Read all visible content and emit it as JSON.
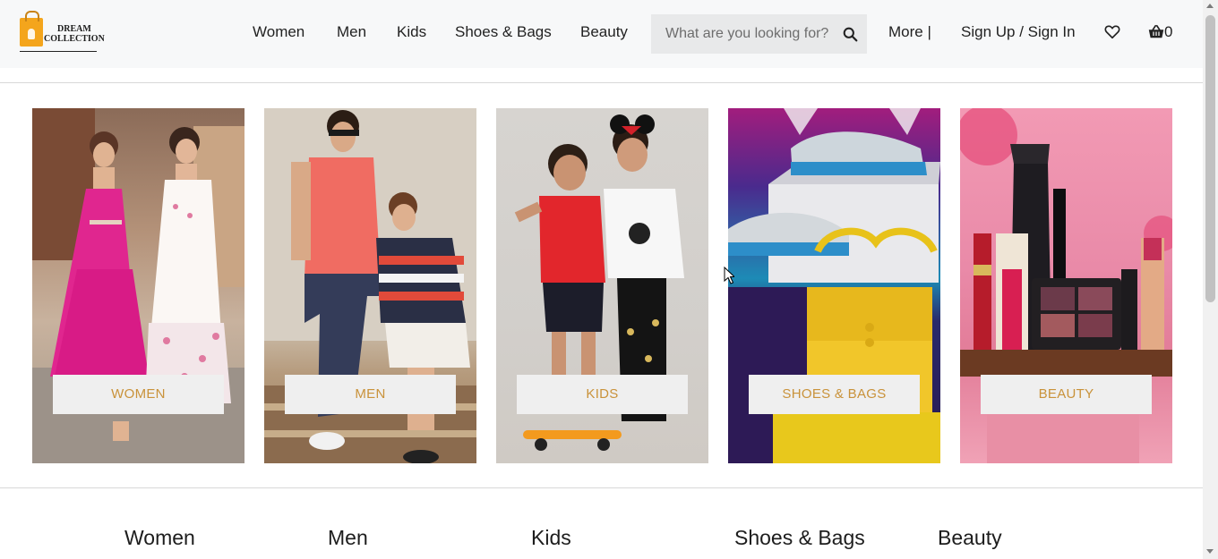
{
  "brand": {
    "logo_line1": "DREAM",
    "logo_line2": "COLLECTION"
  },
  "nav": {
    "items": [
      "Women",
      "Men",
      "Kids",
      "Shoes & Bags",
      "Beauty"
    ],
    "more": "More |",
    "signin": "Sign Up / Sign In",
    "cart_count": "0"
  },
  "search": {
    "placeholder": "What are you looking for?",
    "icon": "search-icon"
  },
  "icons": {
    "wishlist": "heart-icon",
    "cart": "basket-icon"
  },
  "categories": [
    {
      "label": "WOMEN",
      "image": "women-fashion-photo"
    },
    {
      "label": "MEN",
      "image": "men-fashion-photo"
    },
    {
      "label": "KIDS",
      "image": "kids-fashion-photo"
    },
    {
      "label": "SHOES & BAGS",
      "image": "sneakers-and-yellow-bag-photo"
    },
    {
      "label": "BEAUTY",
      "image": "cosmetics-products-photo"
    }
  ],
  "footer_headings": [
    "Women",
    "Men",
    "Kids",
    "Shoes & Bags",
    "Beauty"
  ],
  "colors": {
    "label_text": "#c9923a",
    "label_bg": "#efefef",
    "header_bg": "#f7f8f9",
    "search_bg": "#e8e9ea"
  }
}
